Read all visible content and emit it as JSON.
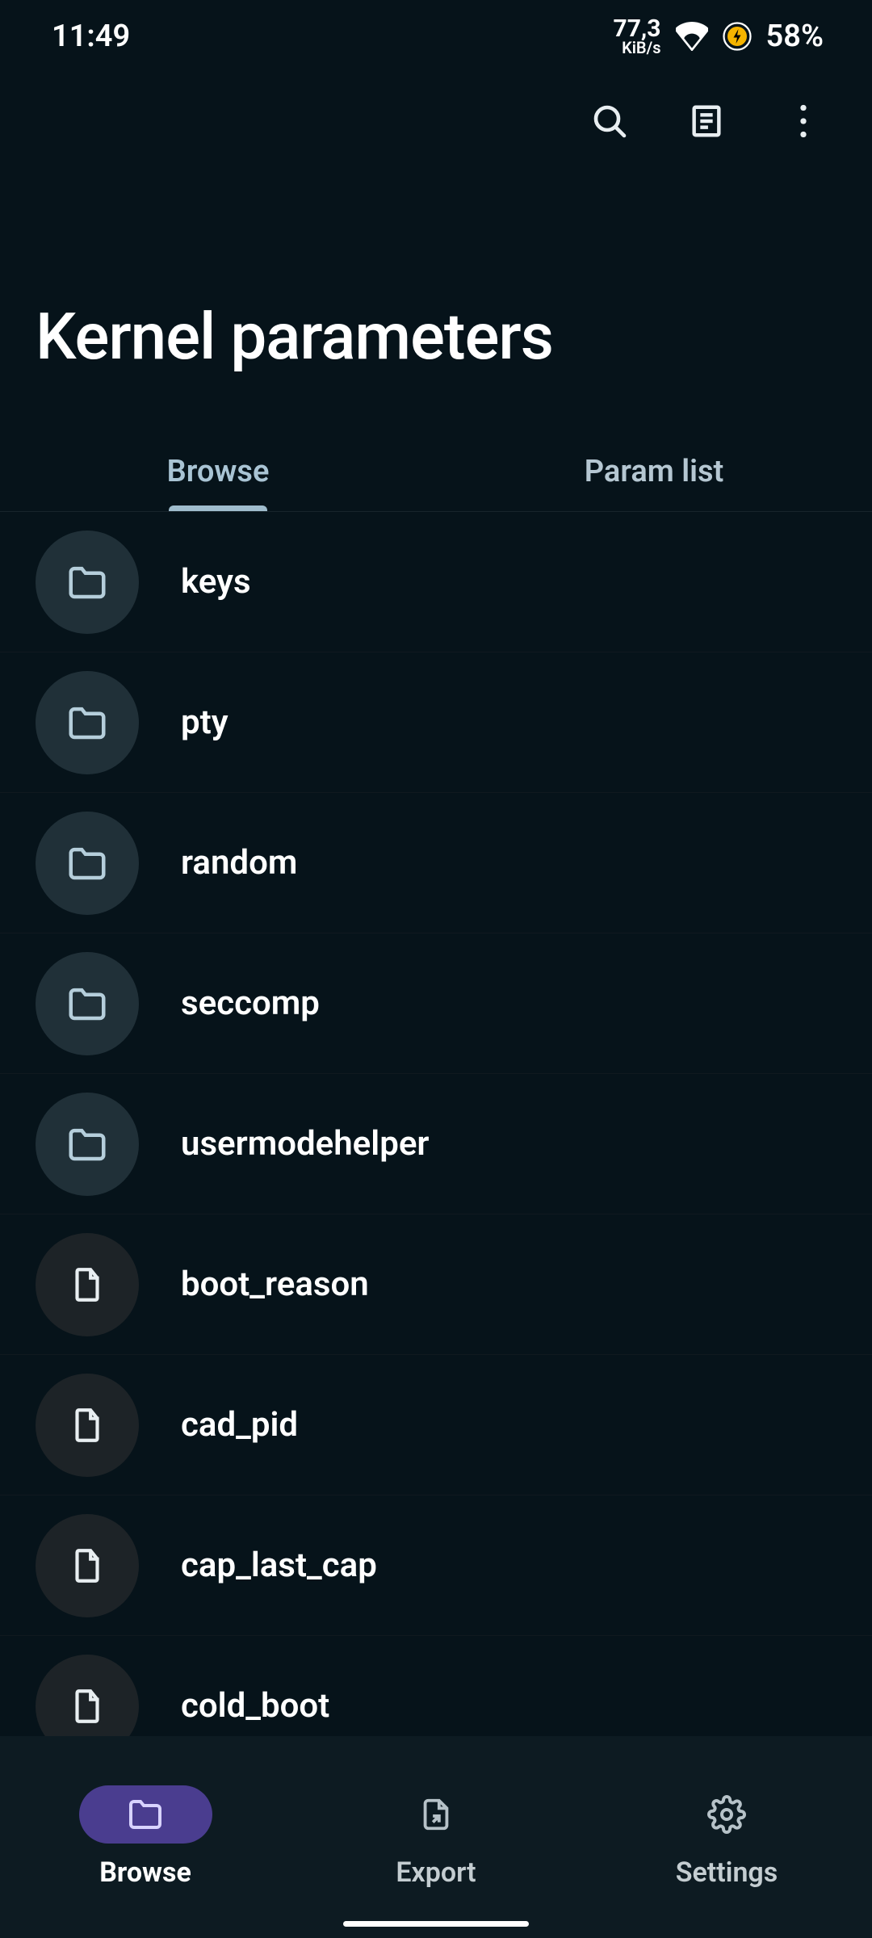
{
  "status": {
    "time": "11:49",
    "speed_value": "77,3",
    "speed_unit": "KiB/s",
    "battery": "58%"
  },
  "header": {
    "title": "Kernel parameters"
  },
  "tabs": {
    "browse": "Browse",
    "param_list": "Param list",
    "active": "browse"
  },
  "items": [
    {
      "name": "keys",
      "type": "folder"
    },
    {
      "name": "pty",
      "type": "folder"
    },
    {
      "name": "random",
      "type": "folder"
    },
    {
      "name": "seccomp",
      "type": "folder"
    },
    {
      "name": "usermodehelper",
      "type": "folder"
    },
    {
      "name": "boot_reason",
      "type": "file"
    },
    {
      "name": "cad_pid",
      "type": "file"
    },
    {
      "name": "cap_last_cap",
      "type": "file"
    },
    {
      "name": "cold_boot",
      "type": "file"
    }
  ],
  "nav": {
    "browse": "Browse",
    "export": "Export",
    "settings": "Settings",
    "active": "browse"
  }
}
